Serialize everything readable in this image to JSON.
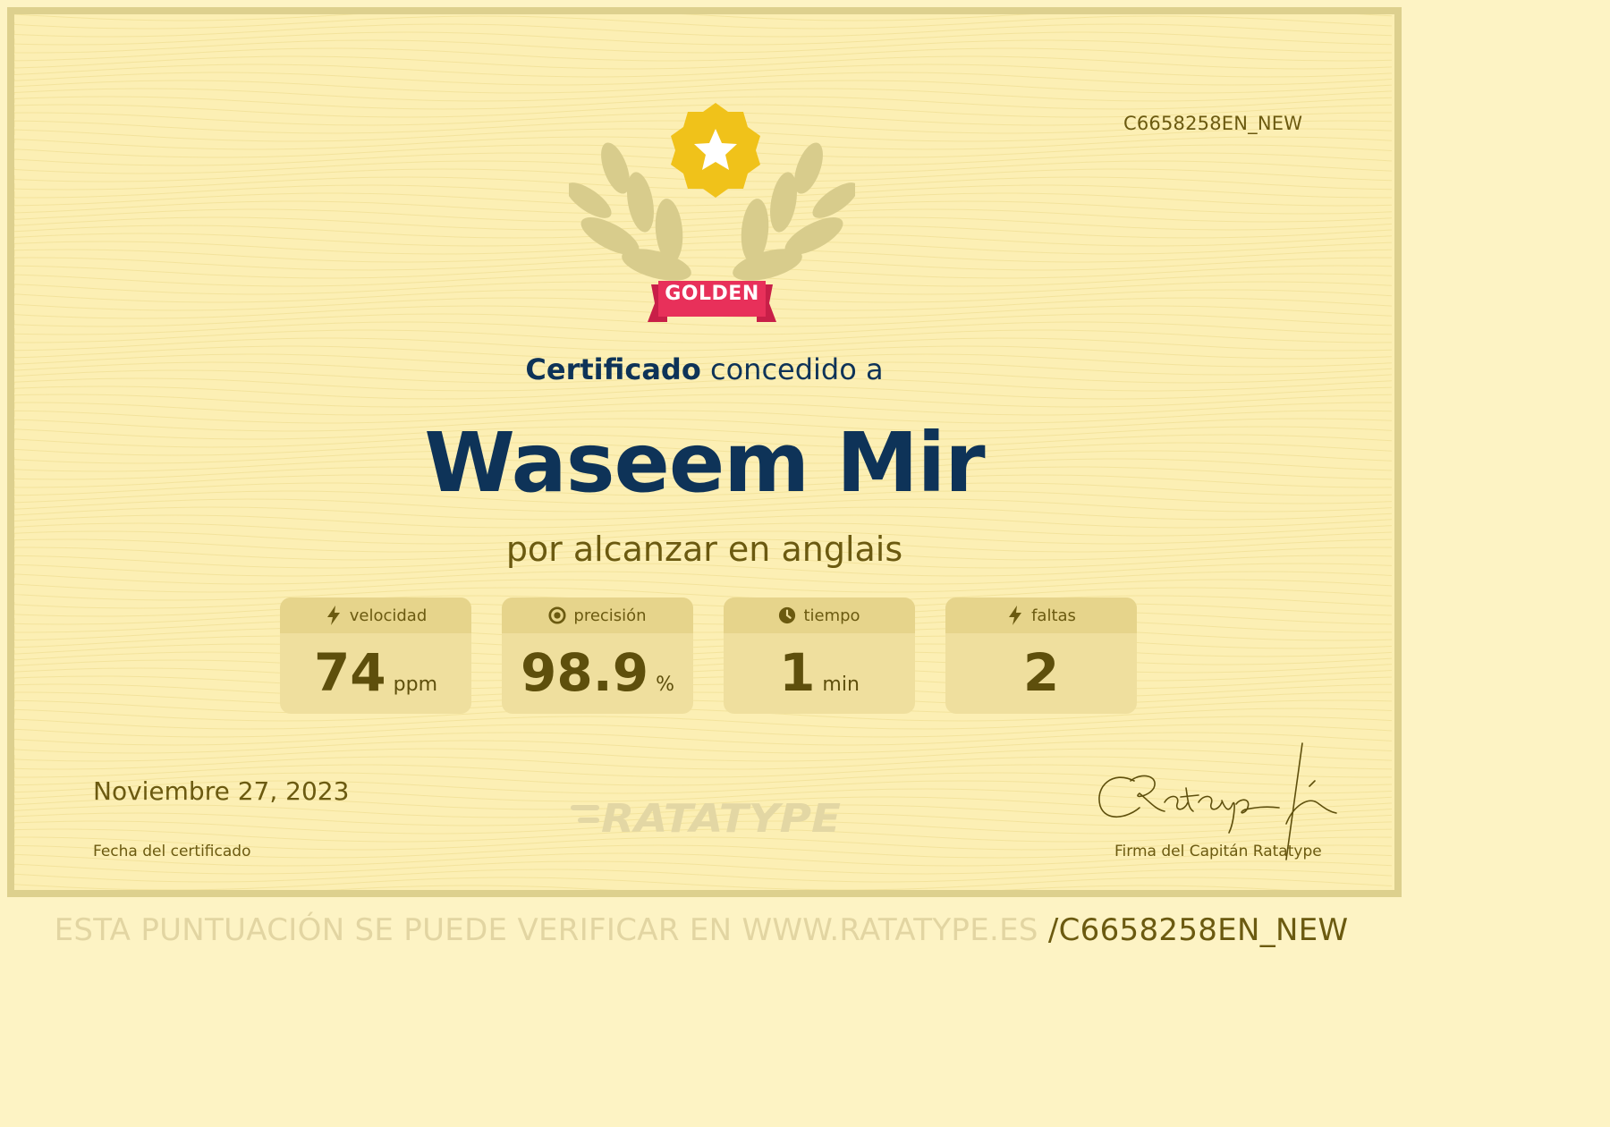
{
  "certificate": {
    "code": "C6658258EN_NEW",
    "badge_label": "GOLDEN",
    "heading_bold": "Certificado",
    "heading_rest": " concedido a",
    "recipient": "Waseem Mir",
    "subtitle": "por alcanzar en anglais",
    "date": "Noviembre 27, 2023",
    "date_label": "Fecha del certificado",
    "signature_label": "Firma del Capitán Ratatype",
    "logo_text": "RATATYPE"
  },
  "stats": [
    {
      "label": "velocidad",
      "value": "74",
      "unit": "ppm",
      "icon": "lightning-icon"
    },
    {
      "label": "precisión",
      "value": "98.9",
      "unit": "%",
      "icon": "target-icon"
    },
    {
      "label": "tiempo",
      "value": "1",
      "unit": "min",
      "icon": "clock-icon"
    },
    {
      "label": "faltas",
      "value": "2",
      "unit": "",
      "icon": "lightning-icon"
    }
  ],
  "footer": {
    "verify_text": "ESTA PUNTUACIÓN SE PUEDE VERIFICAR EN WWW.RATATYPE.ES ",
    "verify_code": "/C6658258EN_NEW"
  },
  "colors": {
    "background": "#fcefb4",
    "navy": "#0e3358",
    "olive": "#6b5a10",
    "ribbon": "#e8305a",
    "star_badge": "#f0c21a",
    "laurel": "#d8cc8c"
  }
}
